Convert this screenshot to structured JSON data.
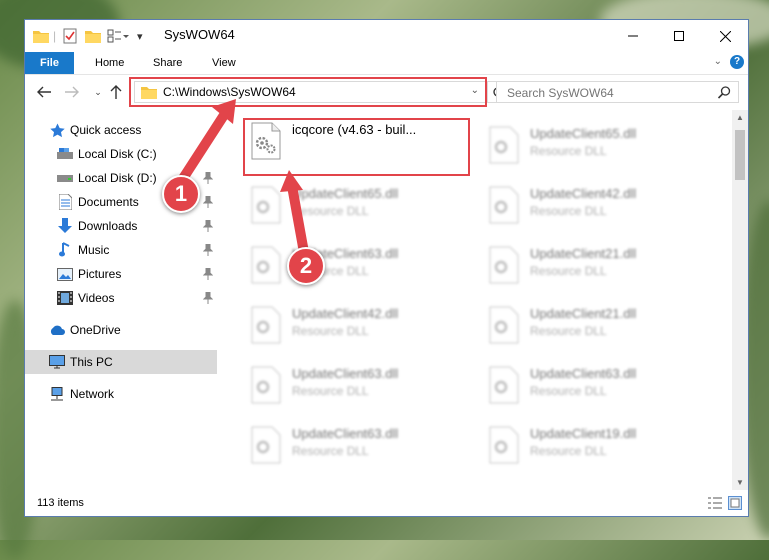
{
  "window": {
    "title": "SysWOW64",
    "controls": [
      "minimize",
      "maximize",
      "close"
    ]
  },
  "ribbon": {
    "tabs": [
      "File",
      "Home",
      "Share",
      "View"
    ]
  },
  "address": {
    "path": "C:\\Windows\\SysWOW64",
    "search_placeholder": "Search SysWOW64"
  },
  "sidebar": {
    "items": [
      {
        "label": "Quick access",
        "icon": "star-icon"
      },
      {
        "label": "Local Disk (C:)",
        "icon": "drive-icon"
      },
      {
        "label": "Local Disk (D:)",
        "icon": "drive-icon"
      },
      {
        "label": "Documents",
        "icon": "documents-icon"
      },
      {
        "label": "Downloads",
        "icon": "download-arrow-icon"
      },
      {
        "label": "Music",
        "icon": "music-note-icon"
      },
      {
        "label": "Pictures",
        "icon": "pictures-icon"
      },
      {
        "label": "Videos",
        "icon": "film-icon"
      },
      {
        "label": "OneDrive",
        "icon": "cloud-icon"
      },
      {
        "label": "This PC",
        "icon": "computer-icon"
      },
      {
        "label": "Network",
        "icon": "network-icon"
      }
    ],
    "selected": "This PC"
  },
  "files": {
    "highlighted": {
      "name": "icqcore (v4.63 - buil...",
      "type": ""
    },
    "col1": [
      {
        "name": "UpdateClient65.dll",
        "type": "Resource DLL"
      },
      {
        "name": "UpdateClient63.dll",
        "type": "Resource DLL"
      },
      {
        "name": "UpdateClient42.dll",
        "type": "Resource DLL"
      },
      {
        "name": "UpdateClient63.dll",
        "type": "Resource DLL"
      },
      {
        "name": "UpdateClient63.dll",
        "type": "Resource DLL"
      }
    ],
    "col2": [
      {
        "name": "UpdateClient65.dll",
        "type": "Resource DLL"
      },
      {
        "name": "UpdateClient42.dll",
        "type": "Resource DLL"
      },
      {
        "name": "UpdateClient21.dll",
        "type": "Resource DLL"
      },
      {
        "name": "UpdateClient21.dll",
        "type": "Resource DLL"
      },
      {
        "name": "UpdateClient63.dll",
        "type": "Resource DLL"
      },
      {
        "name": "UpdateClient19.dll",
        "type": "Resource DLL"
      }
    ]
  },
  "status": {
    "item_count": "113 items"
  },
  "callouts": [
    "1",
    "2"
  ],
  "colors": {
    "accent": "#1979ca",
    "highlight": "#e2444a",
    "selected_bg": "#d9d9d9"
  }
}
